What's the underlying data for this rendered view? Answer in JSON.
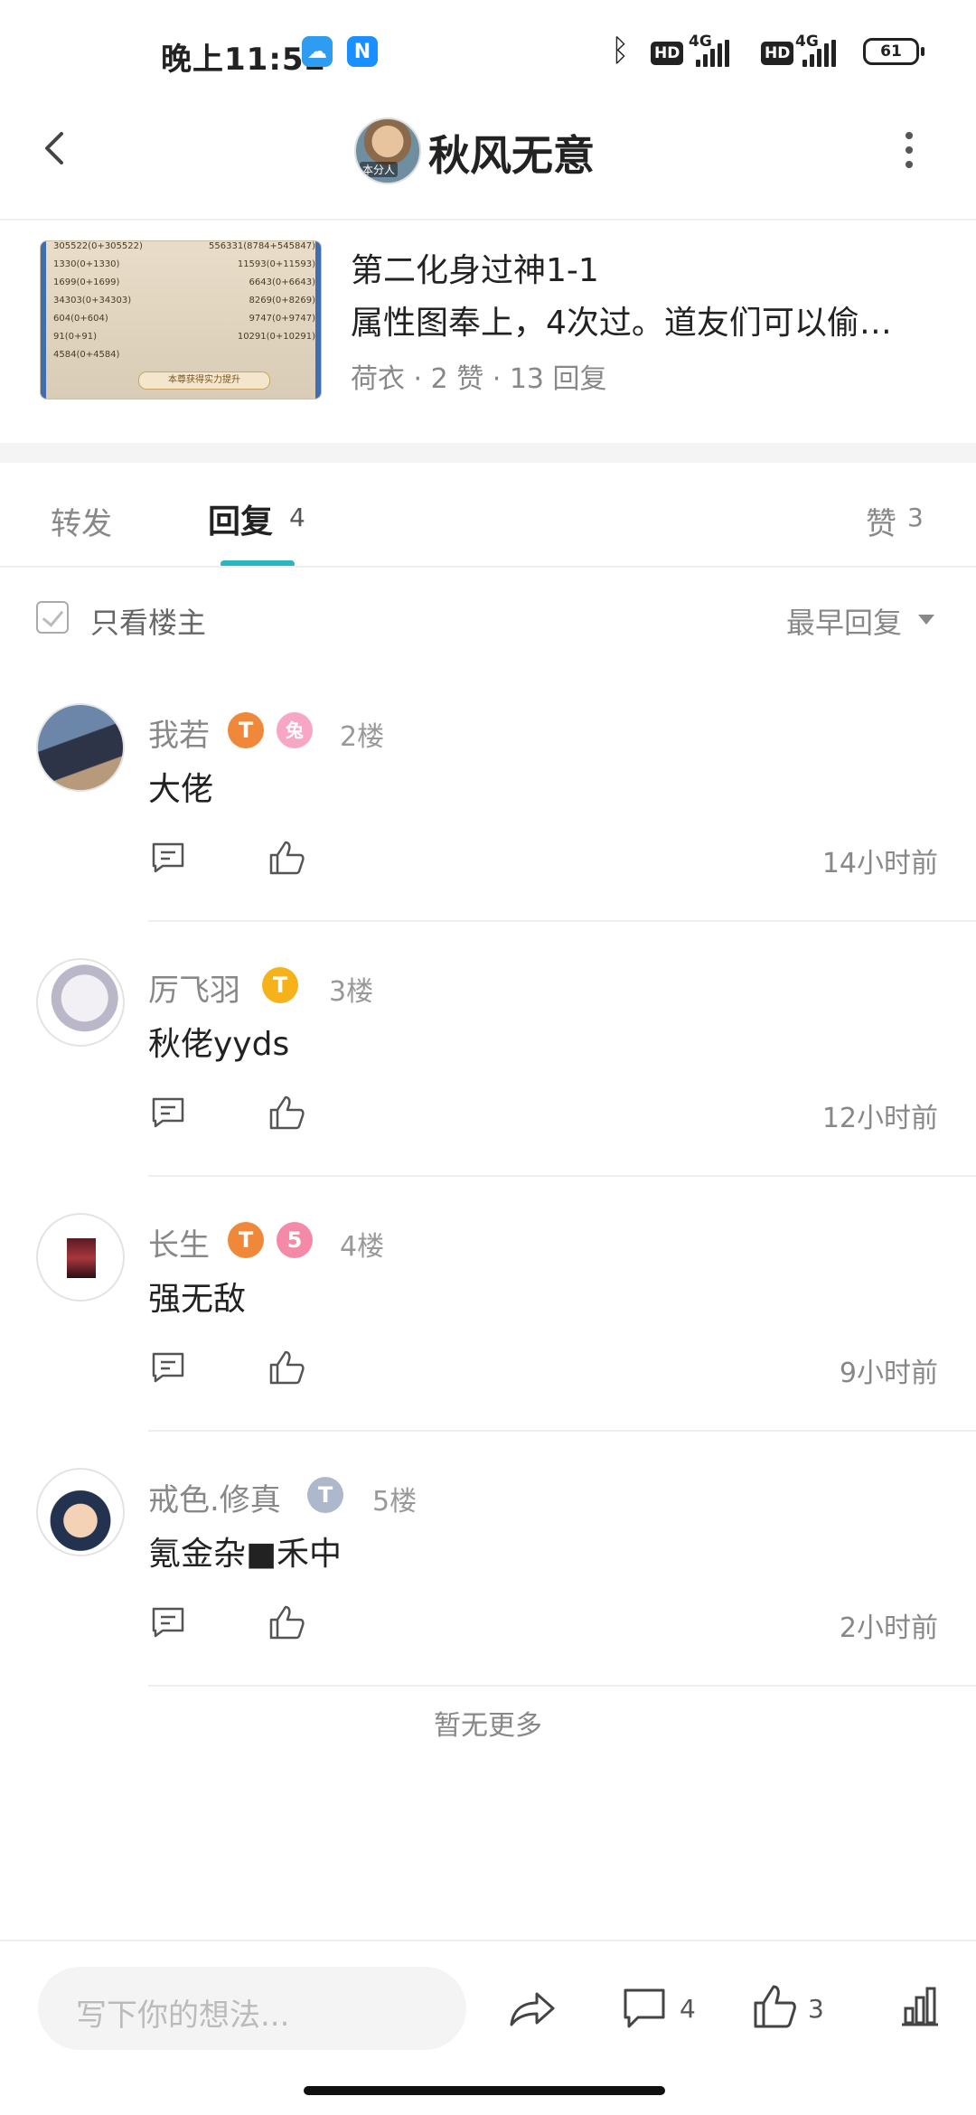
{
  "status_bar": {
    "time": "晚上11:52",
    "hd": "HD",
    "net": "4G",
    "battery": "61"
  },
  "header": {
    "title": "秋风无意",
    "avatar_tag": "本分人"
  },
  "post": {
    "title": "第二化身过神1-1",
    "description": "属性图奉上，4次过。道友们可以偷…",
    "meta": "荷衣 · 2 赞 · 13 回复",
    "thumbnail_rows": [
      [
        "305522(0+305522)",
        "556331(8784+545847)"
      ],
      [
        "1330(0+1330)",
        "11593(0+11593)"
      ],
      [
        "1699(0+1699)",
        "6643(0+6643)"
      ],
      [
        "34303(0+34303)",
        "8269(0+8269)"
      ],
      [
        "604(0+604)",
        "9747(0+9747)"
      ],
      [
        "91(0+91)",
        "10291(0+10291)"
      ],
      [
        "4584(0+4584)",
        ""
      ]
    ],
    "thumbnail_banner": "本尊获得实力提升"
  },
  "tabs": {
    "forward": "转发",
    "reply": "回复",
    "reply_count": "4",
    "like": "赞",
    "like_count": "3"
  },
  "filter": {
    "only_host": "只看楼主",
    "sort": "最早回复"
  },
  "comments": [
    {
      "name": "我若",
      "floor": "2楼",
      "text": "大佬",
      "time": "14小时前",
      "badge": "T",
      "badge_color": "#f0883a",
      "badge2": "兔",
      "badge2_color": "#f7a7c5"
    },
    {
      "name": "厉飞羽",
      "floor": "3楼",
      "text": "秋佬yyds",
      "time": "12小时前",
      "badge": "T",
      "badge_color": "#f5b21b"
    },
    {
      "name": "长生",
      "floor": "4楼",
      "text": "强无敌",
      "time": "9小时前",
      "badge": "T",
      "badge_color": "#f0883a",
      "badge2": "5",
      "badge2_color": "#f58aa8"
    },
    {
      "name": "戒色.修真",
      "floor": "5楼",
      "text": "氪金杂■禾中",
      "time": "2小时前",
      "badge": "T",
      "badge_color": "#aeb8cc"
    }
  ],
  "no_more": "暂无更多",
  "bottom_bar": {
    "placeholder": "写下你的想法...",
    "comment_count": "4",
    "like_count": "3"
  },
  "colors": {
    "accent": "#2bb5c0",
    "text_secondary": "#888888"
  }
}
